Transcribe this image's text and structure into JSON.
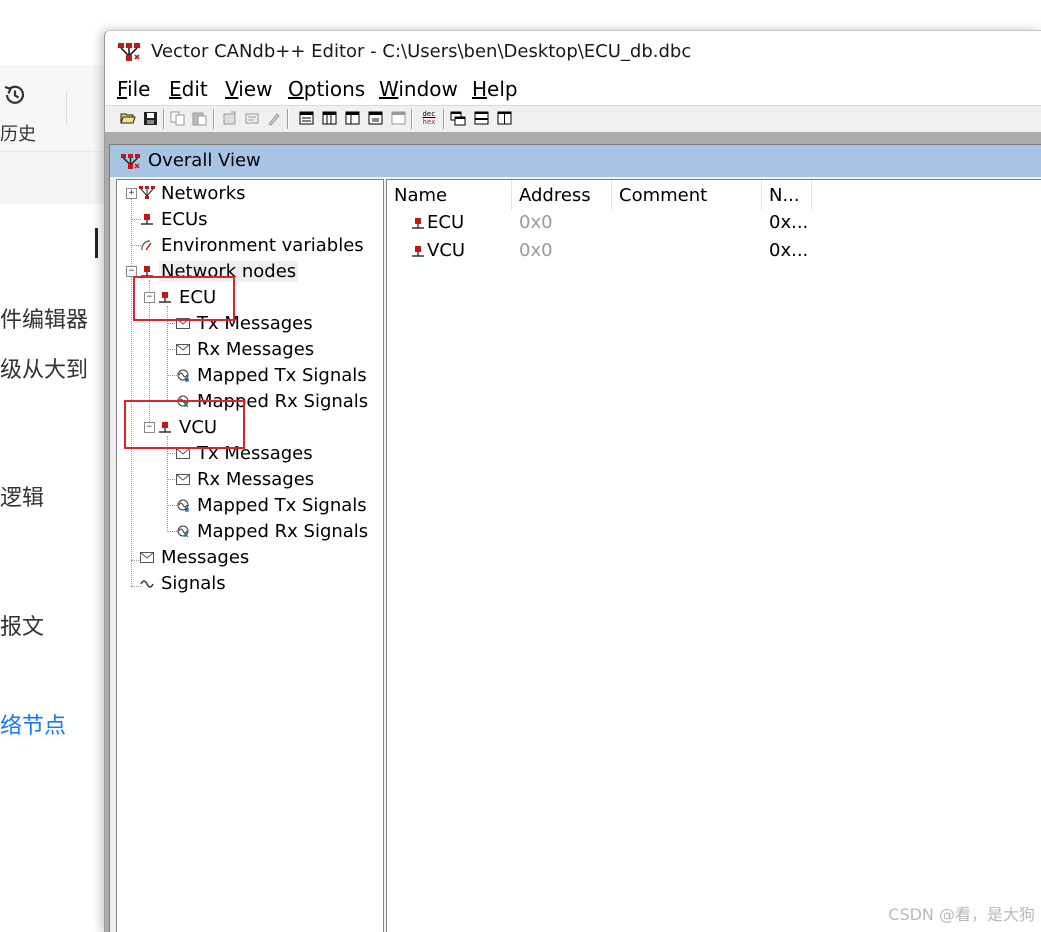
{
  "background_page": {
    "history_label": "历史",
    "text_lines": [
      "件编辑器",
      "级从大到",
      "逻辑",
      "报文",
      "络节点"
    ]
  },
  "window": {
    "title": "Vector CANdb++ Editor - C:\\Users\\ben\\Desktop\\ECU_db.dbc",
    "menu": [
      {
        "label": "File",
        "mnemonic": "F",
        "rest": "ile"
      },
      {
        "label": "Edit",
        "mnemonic": "E",
        "rest": "dit"
      },
      {
        "label": "View",
        "mnemonic": "V",
        "rest": "iew"
      },
      {
        "label": "Options",
        "mnemonic": "O",
        "rest": "ptions"
      },
      {
        "label": "Window",
        "mnemonic": "W",
        "rest": "indow"
      },
      {
        "label": "Help",
        "mnemonic": "H",
        "rest": "elp"
      }
    ],
    "toolbar": {
      "hex_button_top": "dec",
      "hex_button_bottom": "hex"
    }
  },
  "overall_view": {
    "title": "Overall View",
    "tree": {
      "networks": "Networks",
      "ecus": "ECUs",
      "environment_variables": "Environment variables",
      "network_nodes": "Network nodes",
      "nodes": [
        {
          "name": "ECU",
          "children": [
            "Tx Messages",
            "Rx Messages",
            "Mapped Tx Signals",
            "Mapped Rx Signals"
          ]
        },
        {
          "name": "VCU",
          "children": [
            "Tx Messages",
            "Rx Messages",
            "Mapped Tx Signals",
            "Mapped Rx Signals"
          ]
        }
      ],
      "messages": "Messages",
      "signals": "Signals"
    },
    "list": {
      "columns": [
        "Name",
        "Address",
        "Comment",
        "N..."
      ],
      "rows": [
        {
          "name": "ECU",
          "address": "0x0",
          "comment": "",
          "n": "0x..."
        },
        {
          "name": "VCU",
          "address": "0x0",
          "comment": "",
          "n": "0x..."
        }
      ]
    }
  },
  "watermark": "CSDN @看，是大狗",
  "colors": {
    "child_title_bar": "#a8c4e4",
    "annotation_red": "#d9262c",
    "link_blue": "#1677ff"
  }
}
